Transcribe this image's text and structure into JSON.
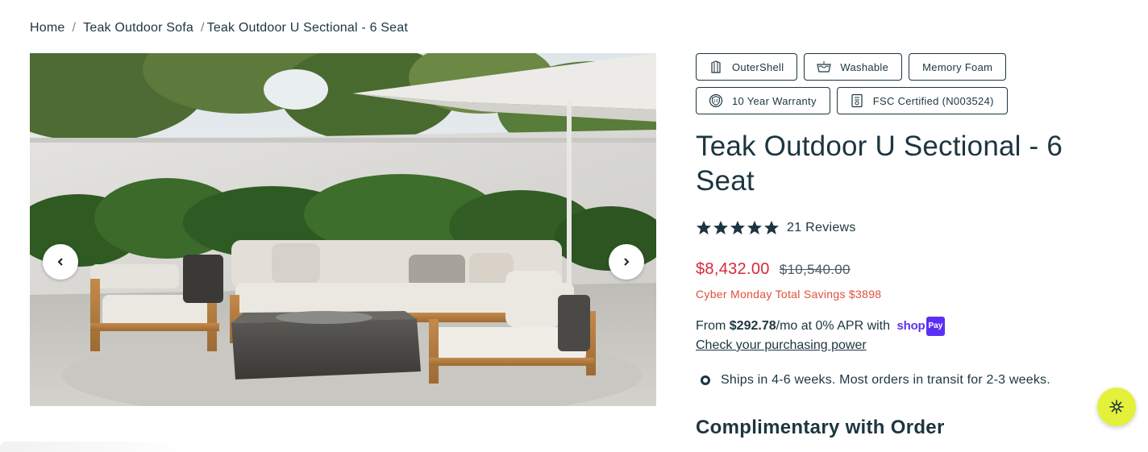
{
  "breadcrumb": {
    "items": [
      {
        "label": "Home"
      },
      {
        "label": "Teak Outdoor Sofa"
      }
    ],
    "current": "Teak Outdoor U Sectional - 6 Seat",
    "separator": "/"
  },
  "gallery": {
    "prev_icon": "chevron-left-icon",
    "next_icon": "chevron-right-icon"
  },
  "badges": [
    {
      "label": "OuterShell",
      "icon": "outershell-icon"
    },
    {
      "label": "Washable",
      "icon": "washable-icon"
    },
    {
      "label": "Memory Foam",
      "icon": null
    },
    {
      "label": "10 Year Warranty",
      "icon": "warranty-shield-icon"
    },
    {
      "label": "FSC Certified (N003524)",
      "icon": "certificate-icon"
    }
  ],
  "product": {
    "title": "Teak Outdoor U Sectional - 6 Seat",
    "rating": {
      "stars": 5,
      "max": 5,
      "reviews_label": "21 Reviews"
    },
    "price": "$8,432.00",
    "compare_price": "$10,540.00",
    "savings": "Cyber Monday Total Savings $3898",
    "financing": {
      "prefix": "From",
      "amount": "$292.78",
      "suffix": "/mo at 0% APR with",
      "shop_label": "shop",
      "pay_label": "Pay",
      "link": "Check your purchasing power"
    },
    "shipping": "Ships in 4-6 weeks. Most orders in transit for 2-3 weeks.",
    "complimentary_heading": "Complimentary with Order"
  },
  "colors": {
    "text": "#1d3540",
    "sale_price": "#d8283c",
    "savings": "#e0503c",
    "shop_pay": "#5a31f4",
    "fab": "#e4f13a"
  },
  "fab": {
    "icon": "sparkle-icon"
  }
}
